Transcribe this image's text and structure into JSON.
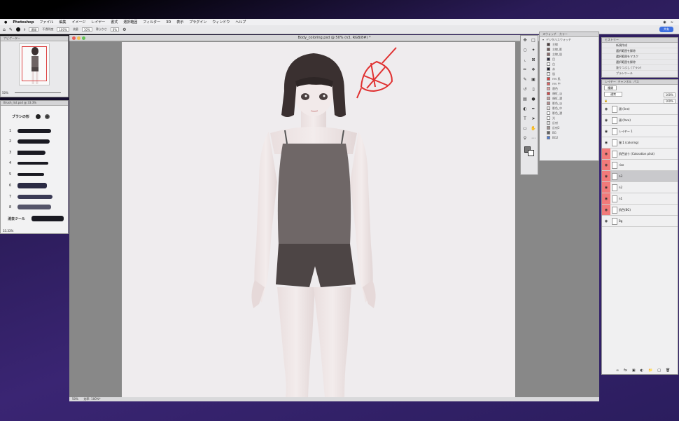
{
  "menubar": {
    "app": "Photoshop",
    "items": [
      "ファイル",
      "編集",
      "イメージ",
      "レイヤー",
      "書式",
      "選択範囲",
      "フィルター",
      "3D",
      "表示",
      "プラグイン",
      "ウィンドウ",
      "ヘルプ"
    ]
  },
  "options": {
    "size": "9",
    "mode": "通常",
    "opacity_label": "不透明度",
    "opacity": "100%",
    "flow_label": "流量",
    "flow": "10%",
    "smooth_label": "滑らかさ",
    "smooth": "0%",
    "share": "共有"
  },
  "navigator": {
    "title": "ナビゲーター",
    "zoom": "50%"
  },
  "brush_panel": {
    "title": "Brush_list.psd @ 33.3%",
    "shape_label": "ブラシの形",
    "rows": [
      "1",
      "2",
      "3",
      "4",
      "5",
      "6",
      "7",
      "8"
    ],
    "eraser_label": "消去ツール",
    "status": "33.33%"
  },
  "document": {
    "title": "Body_coloring.psd @ 50% (n3, RGB/8#) *",
    "status_zoom": "50%",
    "status_info": "効率: 100%*"
  },
  "swatches": {
    "tabs": [
      "スウォッチ",
      "カラー"
    ],
    "group": "デジタルスウォッチ",
    "items": [
      {
        "name": "主線",
        "color": "#4a3a3a"
      },
      {
        "name": "主線_影",
        "color": "#6b5555"
      },
      {
        "name": "主線_肌",
        "color": "#8a6a6a"
      },
      {
        "name": "目",
        "color": "#2a2a40"
      },
      {
        "name": "白",
        "color": "#f5f5f5"
      },
      {
        "name": "赤",
        "color": "#1a1a2a"
      },
      {
        "name": "肌",
        "color": "#f0f0f0"
      },
      {
        "name": "rev 肌",
        "color": "#d84040"
      },
      {
        "name": "rev 中",
        "color": "#e06060"
      },
      {
        "name": "唇色",
        "color": "#e0a0a0"
      },
      {
        "name": "頬紅_淡",
        "color": "#d84848"
      },
      {
        "name": "頬紅_濃",
        "color": "#c8a0a0"
      },
      {
        "name": "影色_淡",
        "color": "#b89090"
      },
      {
        "name": "影色_中",
        "color": "#e8e0e0"
      },
      {
        "name": "影色_濃",
        "color": "#ffffff"
      },
      {
        "name": "光",
        "color": "#ffffff"
      },
      {
        "name": "反射",
        "color": "#e0e0e0"
      },
      {
        "name": "反射2",
        "color": "#a09090"
      },
      {
        "name": "BG",
        "color": "#606060"
      },
      {
        "name": "BG2",
        "color": "#4a7ad8"
      }
    ]
  },
  "history": {
    "tabs": [
      "ヒストリー"
    ],
    "items": [
      "新規作成",
      "選択範囲を解除",
      "選択範囲をマスク",
      "選択範囲を解除",
      "塗りつぶし (ブラシ)",
      "ブラシツール"
    ]
  },
  "layers": {
    "tabs": [
      "レイヤー",
      "チャンネル",
      "パス"
    ],
    "kind": "種類",
    "blend": "通常",
    "opacity": "100%",
    "fill": "100%",
    "items": [
      {
        "name": "顔 (line)",
        "red": false,
        "eye": true
      },
      {
        "name": "顔 (face)",
        "red": false,
        "eye": true
      },
      {
        "name": "レイヤー 1",
        "red": false,
        "eye": true
      },
      {
        "name": "服 1 (coloring)",
        "red": false,
        "eye": true
      },
      {
        "name": "肌色塗り (Coloration pilot)",
        "red": true,
        "eye": true
      },
      {
        "name": "rise",
        "red": true,
        "eye": true
      },
      {
        "name": "n3",
        "red": true,
        "eye": true,
        "selected": true
      },
      {
        "name": "n2",
        "red": true,
        "eye": true
      },
      {
        "name": "n1",
        "red": true,
        "eye": true
      },
      {
        "name": "肌色(BG)",
        "red": true,
        "eye": true
      },
      {
        "name": "Bg",
        "red": false,
        "eye": true
      }
    ]
  }
}
